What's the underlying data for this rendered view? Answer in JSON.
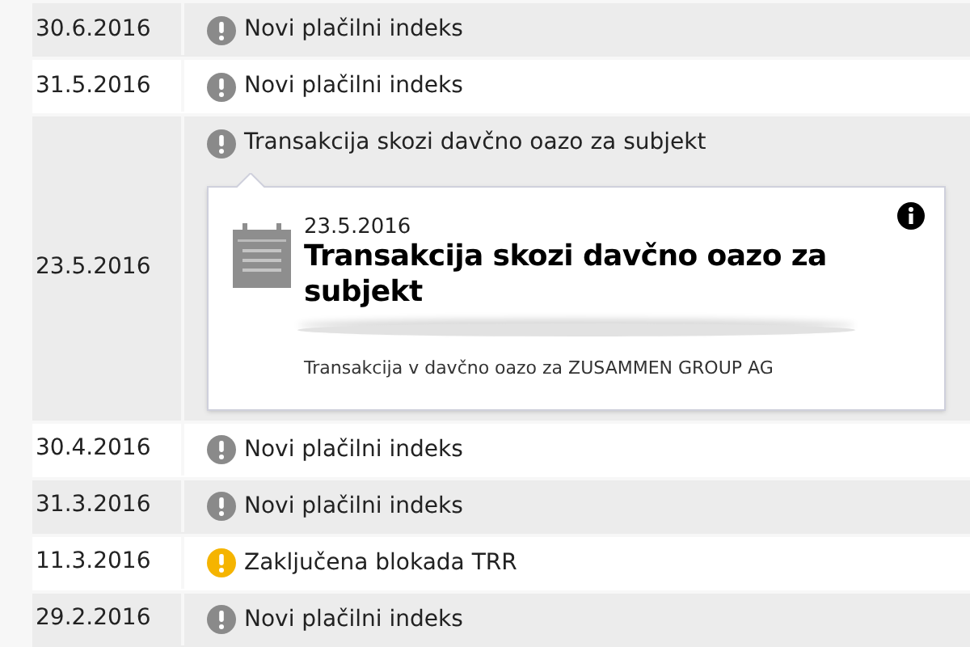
{
  "rows": [
    {
      "date": "30.6.2016",
      "kind": "info",
      "message": "Novi plačilni indeks"
    },
    {
      "date": "31.5.2016",
      "kind": "info",
      "message": "Novi plačilni indeks"
    },
    {
      "date": "23.5.2016",
      "kind": "info",
      "message": "Transakcija skozi davčno oazo za subjekt",
      "expanded": true,
      "detail": {
        "date": "23.5.2016",
        "title": "Transakcija skozi davčno oazo za subjekt",
        "description": "Transakcija v davčno oazo za ZUSAMMEN GROUP AG"
      }
    },
    {
      "date": "30.4.2016",
      "kind": "info",
      "message": "Novi plačilni indeks"
    },
    {
      "date": "31.3.2016",
      "kind": "info",
      "message": "Novi plačilni indeks"
    },
    {
      "date": "11.3.2016",
      "kind": "warning",
      "message": "Zaključena blokada TRR"
    },
    {
      "date": "29.2.2016",
      "kind": "info",
      "message": "Novi plačilni indeks"
    }
  ]
}
